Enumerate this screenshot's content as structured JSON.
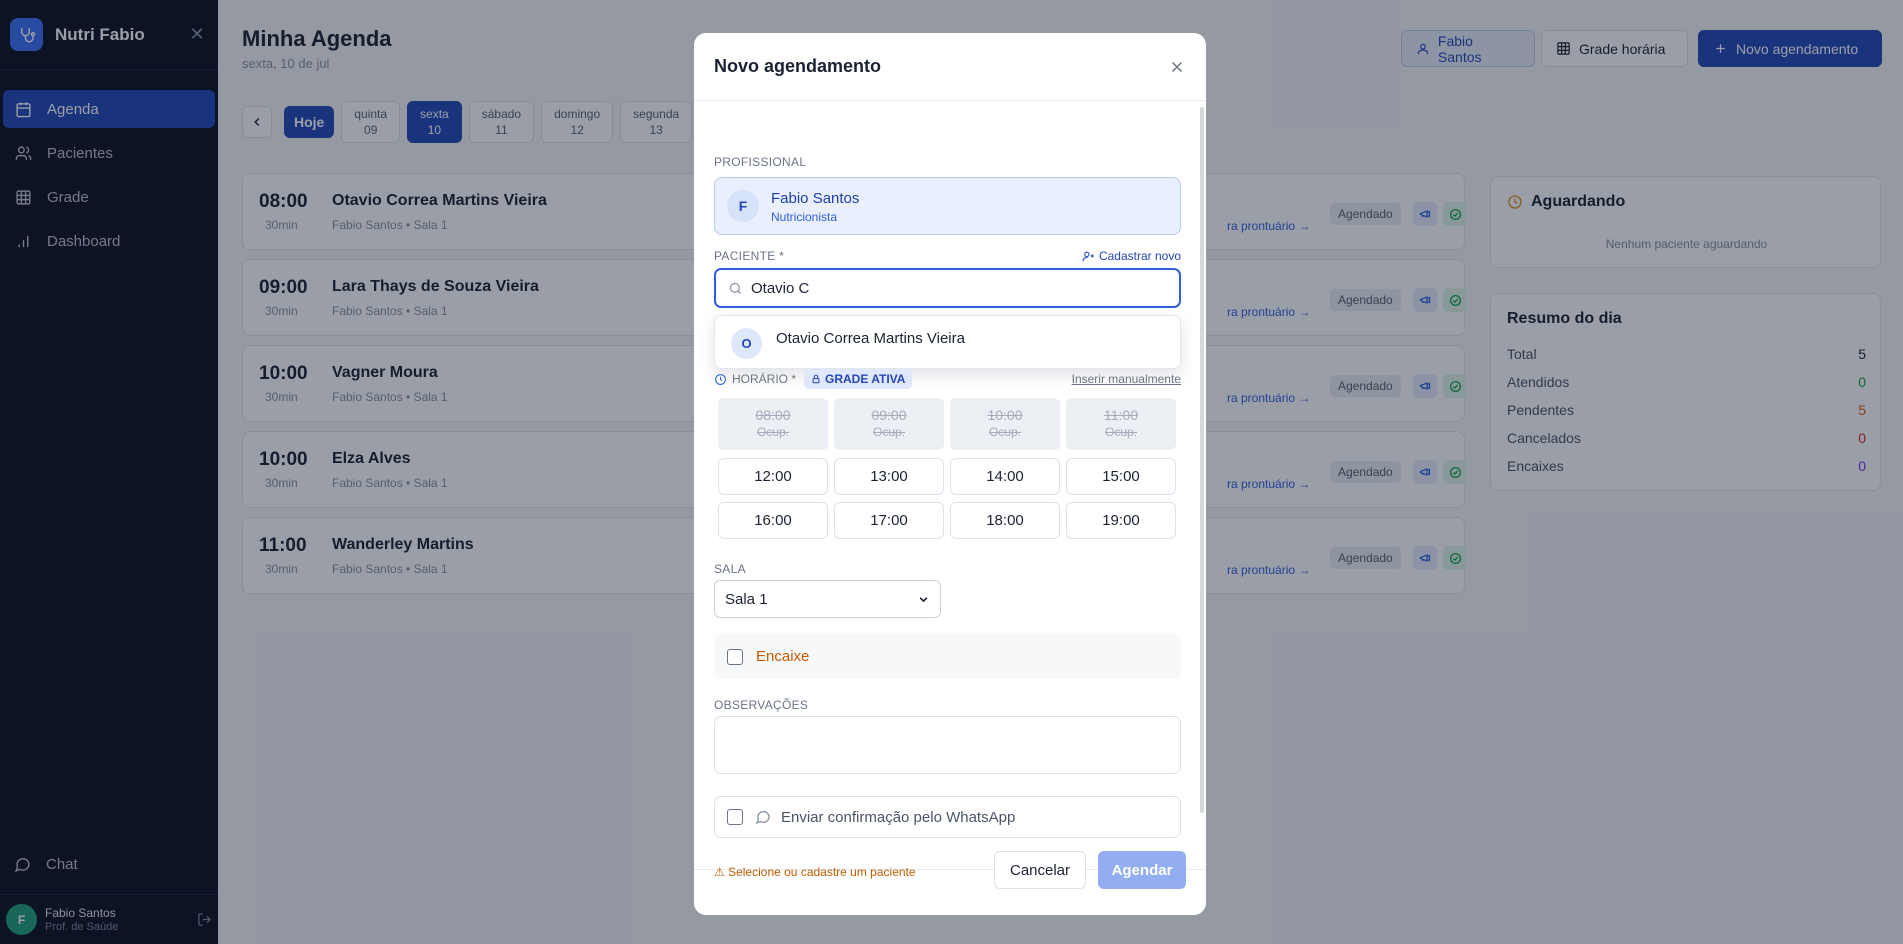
{
  "sidebar": {
    "brand": "Nutri Fabio",
    "items": [
      {
        "label": "Agenda"
      },
      {
        "label": "Pacientes"
      },
      {
        "label": "Grade"
      },
      {
        "label": "Dashboard"
      }
    ],
    "chat": "Chat",
    "user": {
      "initial": "F",
      "name": "Fabio Santos",
      "role": "Prof. de Saúde"
    }
  },
  "header": {
    "title": "Minha Agenda",
    "subtitle": "sexta, 10 de jul",
    "professional_button": "Fabio Santos",
    "grade_button": "Grade horária",
    "new_button": "Novo agendamento"
  },
  "days": {
    "today": "Hoje",
    "list": [
      {
        "name": "quinta",
        "num": "09"
      },
      {
        "name": "sexta",
        "num": "10"
      },
      {
        "name": "sábado",
        "num": "11"
      },
      {
        "name": "domingo",
        "num": "12"
      },
      {
        "name": "segunda",
        "num": "13"
      }
    ]
  },
  "appointments": [
    {
      "time": "08:00",
      "duration": "30min",
      "name": "Otavio Correa Martins Vieira",
      "meta": "Fabio Santos  • Sala 1",
      "link": "ra prontuário →",
      "status": "Agendado"
    },
    {
      "time": "09:00",
      "duration": "30min",
      "name": "Lara Thays de Souza Vieira",
      "meta": "Fabio Santos  • Sala 1",
      "link": "ra prontuário →",
      "status": "Agendado"
    },
    {
      "time": "10:00",
      "duration": "30min",
      "name": "Vagner Moura",
      "meta": "Fabio Santos  • Sala 1",
      "link": "ra prontuário →",
      "status": "Agendado"
    },
    {
      "time": "10:00",
      "duration": "30min",
      "name": "Elza Alves",
      "meta": "Fabio Santos  • Sala 1",
      "link": "ra prontuário →",
      "status": "Agendado"
    },
    {
      "time": "11:00",
      "duration": "30min",
      "name": "Wanderley Martins",
      "meta": "Fabio Santos  • Sala 1",
      "link": "ra prontuário →",
      "status": "Agendado"
    }
  ],
  "waiting": {
    "title": "Aguardando",
    "empty": "Nenhum paciente aguardando"
  },
  "summary": {
    "title": "Resumo do dia",
    "rows": [
      {
        "label": "Total",
        "value": "5",
        "color": "#1b2333"
      },
      {
        "label": "Atendidos",
        "value": "0",
        "color": "#16a34a"
      },
      {
        "label": "Pendentes",
        "value": "5",
        "color": "#ea580c"
      },
      {
        "label": "Cancelados",
        "value": "0",
        "color": "#dc2626"
      },
      {
        "label": "Encaixes",
        "value": "0",
        "color": "#7c3aed"
      }
    ]
  },
  "modal": {
    "title": "Novo agendamento",
    "professional_label": "PROFISSIONAL",
    "professional": {
      "initial": "F",
      "name": "Fabio Santos",
      "role": "Nutricionista"
    },
    "patient_label": "PACIENTE *",
    "register_link": "Cadastrar novo",
    "search_value": "Otavio C",
    "results": [
      {
        "initial": "O",
        "name": "Otavio Correa Martins Vieira"
      }
    ],
    "time_label": "HORÁRIO *",
    "grade_badge": "GRADE ATIVA",
    "manual_link": "Inserir manualmente",
    "busy_text": "Ocup.",
    "slots": [
      {
        "time": "08:00",
        "busy": true
      },
      {
        "time": "09:00",
        "busy": true
      },
      {
        "time": "10:00",
        "busy": true
      },
      {
        "time": "11:00",
        "busy": true
      },
      {
        "time": "12:00",
        "busy": false
      },
      {
        "time": "13:00",
        "busy": false
      },
      {
        "time": "14:00",
        "busy": false
      },
      {
        "time": "15:00",
        "busy": false
      },
      {
        "time": "16:00",
        "busy": false
      },
      {
        "time": "17:00",
        "busy": false
      },
      {
        "time": "18:00",
        "busy": false
      },
      {
        "time": "19:00",
        "busy": false
      }
    ],
    "room_label": "SALA",
    "room_value": "Sala 1",
    "encaixe_label": "Encaixe",
    "notes_label": "OBSERVAÇÕES",
    "whatsapp_label": "Enviar confirmação pelo WhatsApp",
    "warning": "⚠ Selecione ou cadastre um paciente",
    "cancel": "Cancelar",
    "submit": "Agendar"
  },
  "colors": {
    "primary": "#2447b8",
    "sidebar": "#0b1120",
    "warning": "#c25a00"
  }
}
